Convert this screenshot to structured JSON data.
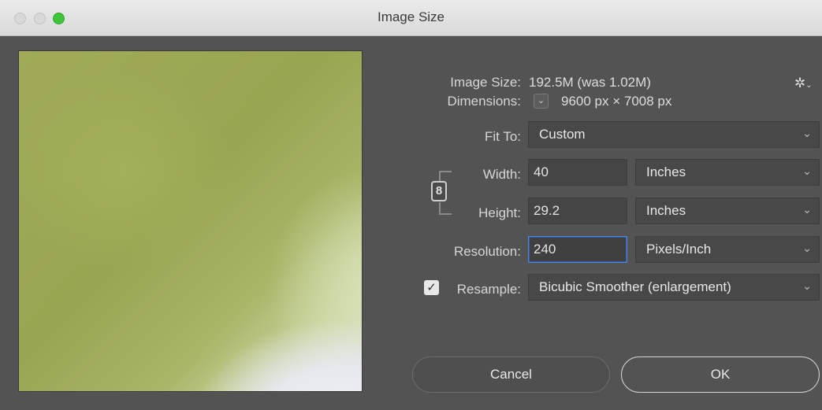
{
  "window": {
    "title": "Image Size"
  },
  "info": {
    "image_size_label": "Image Size:",
    "image_size_value": "192.5M (was 1.02M)",
    "dimensions_label": "Dimensions:",
    "dimensions_value": "9600 px  ×  7008 px"
  },
  "fit_to": {
    "label": "Fit To:",
    "value": "Custom"
  },
  "width": {
    "label": "Width:",
    "value": "40",
    "unit": "Inches"
  },
  "height": {
    "label": "Height:",
    "value": "29.2",
    "unit": "Inches"
  },
  "resolution": {
    "label": "Resolution:",
    "value": "240",
    "unit": "Pixels/Inch"
  },
  "resample": {
    "label": "Resample:",
    "checked": true,
    "value": "Bicubic Smoother (enlargement)"
  },
  "buttons": {
    "cancel": "Cancel",
    "ok": "OK"
  },
  "icons": {
    "gear": "gear-icon",
    "link": "chain-link-icon",
    "chevron": "chevron-down-icon"
  },
  "colors": {
    "accent_focus": "#4f86d8",
    "maximize_green": "#3fc43a",
    "dialog_bg": "#535353"
  }
}
